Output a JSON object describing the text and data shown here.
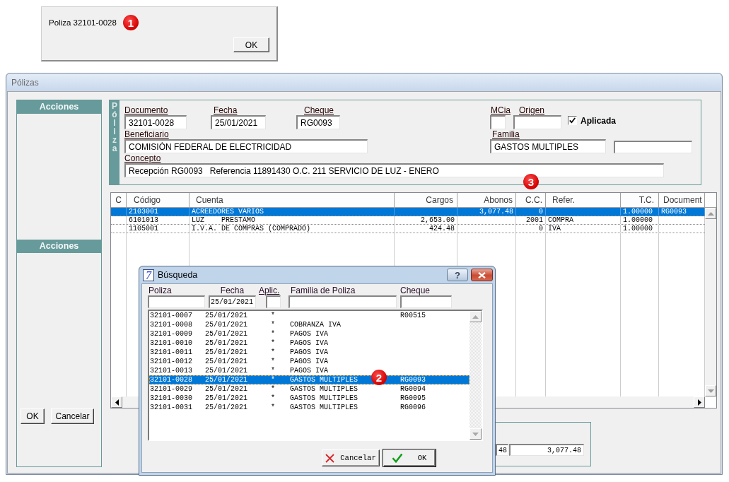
{
  "message_dialog": {
    "message": "Poliza 32101-0028",
    "callout": "1",
    "ok_button": "OK"
  },
  "polizas_window": {
    "title": "Pólizas",
    "actions_panel": {
      "sections": [
        "Acciones",
        "Acciones"
      ],
      "buttons": [
        "OK",
        "Cancelar"
      ]
    },
    "poliza_group": {
      "side_label": "Póliza",
      "callout": "3",
      "fields": [
        {
          "kind": "text",
          "label": "Documento",
          "value": "32101-0028"
        },
        {
          "kind": "text",
          "label": "Fecha",
          "value": "25/01/2021"
        },
        {
          "kind": "text",
          "label": "Cheque",
          "value": "RG0093"
        },
        {
          "kind": "text",
          "label": "MCia"
        },
        {
          "kind": "text",
          "label": "Origen"
        },
        {
          "kind": "checkbox",
          "label": "Aplicada",
          "checked": true
        },
        {
          "kind": "text",
          "label": "Beneficiario",
          "value": "COMISIÓN FEDERAL DE ELECTRICIDAD"
        },
        {
          "kind": "text",
          "label": "Familia",
          "value": "GASTOS MULTIPLES"
        },
        {
          "kind": "text"
        },
        {
          "kind": "text",
          "label": "Concepto",
          "value": "Recepción RG0093   Referencia 11891430 O.C. 211 SERVICIO DE LUZ - ENERO"
        }
      ]
    },
    "grid": {
      "columns": [
        "C",
        "Código",
        "Cuenta",
        "Cargos",
        "Abonos",
        "C.C.",
        "Refer.",
        "T.C.",
        "Document"
      ],
      "rows": [
        {
          "selected": true,
          "codigo": "2103001",
          "cuenta": "ACREEDORES VARIOS",
          "abonos": "3,077.48",
          "c_c": "0",
          "t_c": "1.00000",
          "document": "RG0093"
        },
        {
          "selected": false,
          "codigo": "6101013",
          "cuenta": "LUZ    PRESTAMO",
          "cargos": "2,653.00",
          "c_c": "2001",
          "refer": "COMPRA",
          "t_c": "1.00000"
        },
        {
          "selected": false,
          "codigo": "1105001",
          "cuenta": "I.V.A. DE COMPRAS (COMPRADO)",
          "cargos": "424.48",
          "c_c": "0",
          "refer": "IVA",
          "t_c": "1.00000"
        }
      ]
    },
    "totals": [
      "48",
      "3,077.48"
    ]
  },
  "search_dialog": {
    "app_icon": "7",
    "title": "Búsqueda",
    "help_button": "?",
    "filters": [
      {
        "label": "Poliza",
        "underlined": false
      },
      {
        "label": "Fecha",
        "value": "25/01/2021",
        "underlined": false
      },
      {
        "label": "Aplic.",
        "underlined": true
      },
      {
        "label": "Familia de Poliza",
        "underlined": false
      },
      {
        "label": "Cheque",
        "underlined": false
      }
    ],
    "list": {
      "callout": "2",
      "rows": [
        {
          "selected": false,
          "poliza": "32101-0007",
          "fecha": "25/01/2021",
          "aplic": "*",
          "cheque": "R00515"
        },
        {
          "selected": false,
          "poliza": "32101-0008",
          "fecha": "25/01/2021",
          "aplic": "*",
          "familia": "COBRANZA IVA"
        },
        {
          "selected": false,
          "poliza": "32101-0009",
          "fecha": "25/01/2021",
          "aplic": "*",
          "familia": "PAGOS IVA"
        },
        {
          "selected": false,
          "poliza": "32101-0010",
          "fecha": "25/01/2021",
          "aplic": "*",
          "familia": "PAGOS IVA"
        },
        {
          "selected": false,
          "poliza": "32101-0011",
          "fecha": "25/01/2021",
          "aplic": "*",
          "familia": "PAGOS IVA"
        },
        {
          "selected": false,
          "poliza": "32101-0012",
          "fecha": "25/01/2021",
          "aplic": "*",
          "familia": "PAGOS IVA"
        },
        {
          "selected": false,
          "poliza": "32101-0013",
          "fecha": "25/01/2021",
          "aplic": "*",
          "familia": "PAGOS IVA"
        },
        {
          "selected": true,
          "poliza": "32101-0028",
          "fecha": "25/01/2021",
          "aplic": "*",
          "familia": "GASTOS MULTIPLES",
          "cheque": "RG0093"
        },
        {
          "selected": false,
          "poliza": "32101-0029",
          "fecha": "25/01/2021",
          "aplic": "*",
          "familia": "GASTOS MULTIPLES",
          "cheque": "RG0094"
        },
        {
          "selected": false,
          "poliza": "32101-0030",
          "fecha": "25/01/2021",
          "aplic": "*",
          "familia": "GASTOS MULTIPLES",
          "cheque": "RG0095"
        },
        {
          "selected": false,
          "poliza": "32101-0031",
          "fecha": "25/01/2021",
          "aplic": "*",
          "familia": "GASTOS MULTIPLES",
          "cheque": "RG0096"
        }
      ]
    },
    "buttons": [
      {
        "kind": "cancel",
        "label": "Cancelar",
        "default": false
      },
      {
        "kind": "ok",
        "label": "OK",
        "default": true
      }
    ]
  }
}
